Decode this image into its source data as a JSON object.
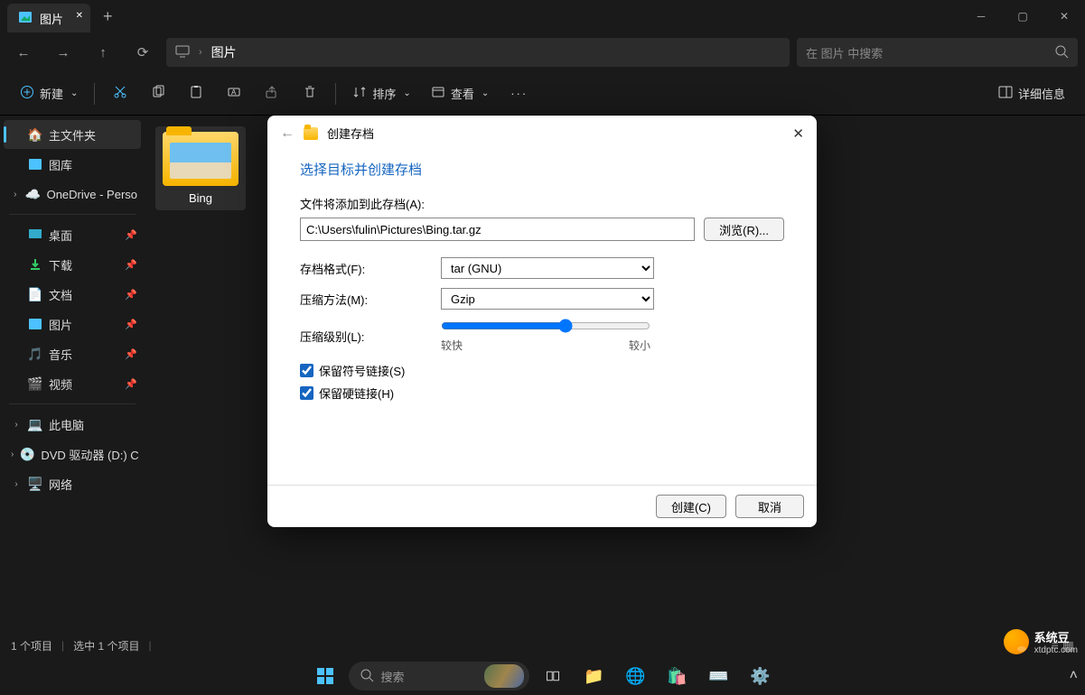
{
  "window": {
    "tab_title": "图片",
    "path_label": "图片",
    "search_placeholder": "在 图片 中搜索"
  },
  "toolbar": {
    "new": "新建",
    "sort": "排序",
    "view": "查看",
    "details": "详细信息"
  },
  "sidebar": {
    "home": "主文件夹",
    "gallery": "图库",
    "onedrive": "OneDrive - Perso",
    "desktop": "桌面",
    "downloads": "下载",
    "documents": "文档",
    "pictures": "图片",
    "music": "音乐",
    "videos": "视频",
    "this_pc": "此电脑",
    "dvd": "DVD 驱动器 (D:) C",
    "network": "网络"
  },
  "content": {
    "items": [
      {
        "name": "Bing",
        "type": "folder"
      }
    ]
  },
  "status": {
    "count": "1 个项目",
    "selected": "选中 1 个项目"
  },
  "dialog": {
    "title": "创建存档",
    "heading": "选择目标并创建存档",
    "path_label": "文件将添加到此存档(A):",
    "path_value": "C:\\Users\\fulin\\Pictures\\Bing.tar.gz",
    "browse": "浏览(R)...",
    "format_label": "存档格式(F):",
    "format_value": "tar (GNU)",
    "method_label": "压缩方法(M):",
    "method_value": "Gzip",
    "level_label": "压缩级别(L):",
    "level_fast": "较快",
    "level_small": "较小",
    "preserve_symlinks": "保留符号链接(S)",
    "preserve_hardlinks": "保留硬链接(H)",
    "create": "创建(C)",
    "cancel": "取消"
  },
  "taskbar": {
    "search": "搜索"
  },
  "watermark": {
    "brand": "系统豆",
    "site": "xtdptc.com"
  }
}
